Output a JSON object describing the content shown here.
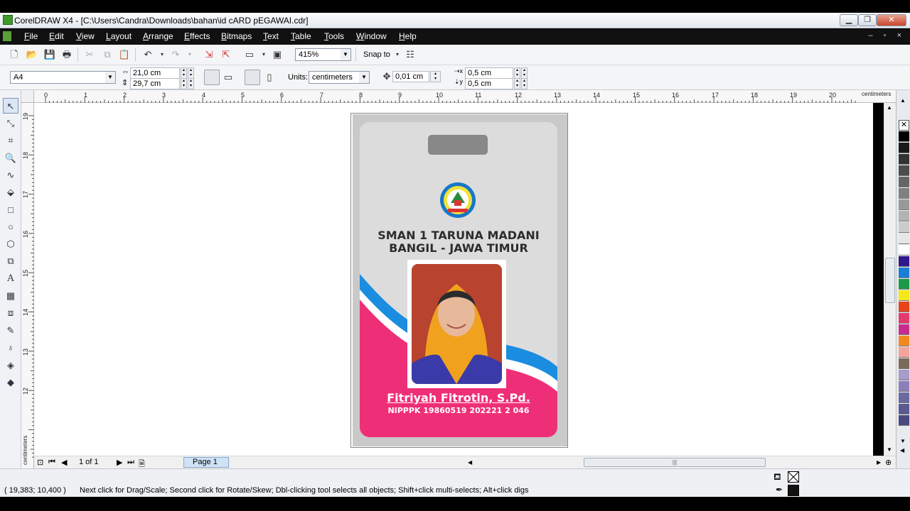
{
  "window": {
    "title": "CorelDRAW X4 - [C:\\Users\\Candra\\Downloads\\bahan\\id cARD pEGAWAI.cdr]",
    "min_glyph": "▁",
    "restore_glyph": "❐",
    "close_glyph": "✕",
    "mdi_controls": "– ▫ ×"
  },
  "menu": [
    "File",
    "Edit",
    "View",
    "Layout",
    "Arrange",
    "Effects",
    "Bitmaps",
    "Text",
    "Table",
    "Tools",
    "Window",
    "Help"
  ],
  "toolbar1": {
    "zoom": "415%",
    "snap_to": "Snap to"
  },
  "toolbar2": {
    "paper_size": "A4",
    "width": "21,0 cm",
    "height": "29,7 cm",
    "units_label": "Units:",
    "units": "centimeters",
    "nudge": "0,01 cm",
    "dup_x": "0,5 cm",
    "dup_y": "0,5 cm"
  },
  "ruler": {
    "h_ticks": [
      "0",
      "1",
      "2",
      "3",
      "4",
      "5",
      "6",
      "7",
      "8",
      "9",
      "10",
      "11",
      "12",
      "13",
      "14",
      "15",
      "16",
      "17",
      "18",
      "19",
      "20"
    ],
    "h_unit": "centimeters",
    "v_ticks": [
      "19",
      "18",
      "17",
      "16",
      "15",
      "14",
      "13",
      "12"
    ],
    "v_unit": "centimeters"
  },
  "page_nav": {
    "count": "1 of 1",
    "tab": "Page 1"
  },
  "status": {
    "coords": "( 19,383; 10,400 )",
    "hint": "Next click for Drag/Scale; Second click for Rotate/Skew; Dbl-clicking tool selects all objects; Shift+click multi-selects; Alt+click digs"
  },
  "card": {
    "school_line1": "SMAN 1 TARUNA MADANI",
    "school_line2": "BANGIL - JAWA TIMUR",
    "name": "Fitriyah Fitrotin, S.Pd.",
    "nip": "NIPPPK 19860519 202221 2 046",
    "pink": "#ee2f78",
    "blue": "#1a8de0"
  },
  "palette": [
    "#000000",
    "#1a1a1a",
    "#333333",
    "#4d4d4d",
    "#666666",
    "#808080",
    "#999999",
    "#b3b3b3",
    "#cccccc",
    "#e6e6e6",
    "#ffffff",
    "#2e1a8a",
    "#1a7fd6",
    "#1b9a48",
    "#f4e81a",
    "#e8431b",
    "#e53a6e",
    "#c72c8c",
    "#f18a1e",
    "#f4a49a",
    "#7a6a5a",
    "#a69bc9",
    "#8a7fb8",
    "#6a6aa0",
    "#5a5a90",
    "#4a4a80"
  ]
}
